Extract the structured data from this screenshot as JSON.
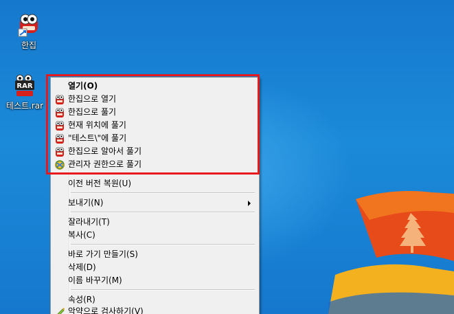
{
  "desktop": {
    "icons": [
      {
        "label": "한집",
        "icon": "hanzip-app-icon"
      },
      {
        "label": "테스트.rar",
        "icon": "rar-archive-icon"
      }
    ]
  },
  "context_menu": {
    "items": [
      {
        "label": "열기(O)",
        "bold": true
      },
      {
        "label": "한집으로 열기",
        "icon": "hanzip-icon"
      },
      {
        "label": "한집으로 풀기",
        "icon": "hanzip-icon"
      },
      {
        "label": "현재 위치에 풀기",
        "icon": "hanzip-icon"
      },
      {
        "label": "\"테스트\\\"에 풀기",
        "icon": "hanzip-icon"
      },
      {
        "label": "한집으로 알아서 풀기",
        "icon": "hanzip-icon"
      },
      {
        "label": "관리자 권한으로 풀기",
        "icon": "admin-shield-icon"
      },
      {
        "label": "이전 버전 복원(U)"
      },
      {
        "label": "보내기(N)",
        "submenu": true
      },
      {
        "label": "잘라내기(T)"
      },
      {
        "label": "복사(C)"
      },
      {
        "label": "바로 가기 만들기(S)"
      },
      {
        "label": "삭제(D)"
      },
      {
        "label": "이름 바꾸기(M)"
      },
      {
        "label": "속성(R)"
      },
      {
        "label": "악약으로 검사하기(V)",
        "icon": "scan-icon"
      }
    ]
  },
  "highlight_color": "#e8191d"
}
